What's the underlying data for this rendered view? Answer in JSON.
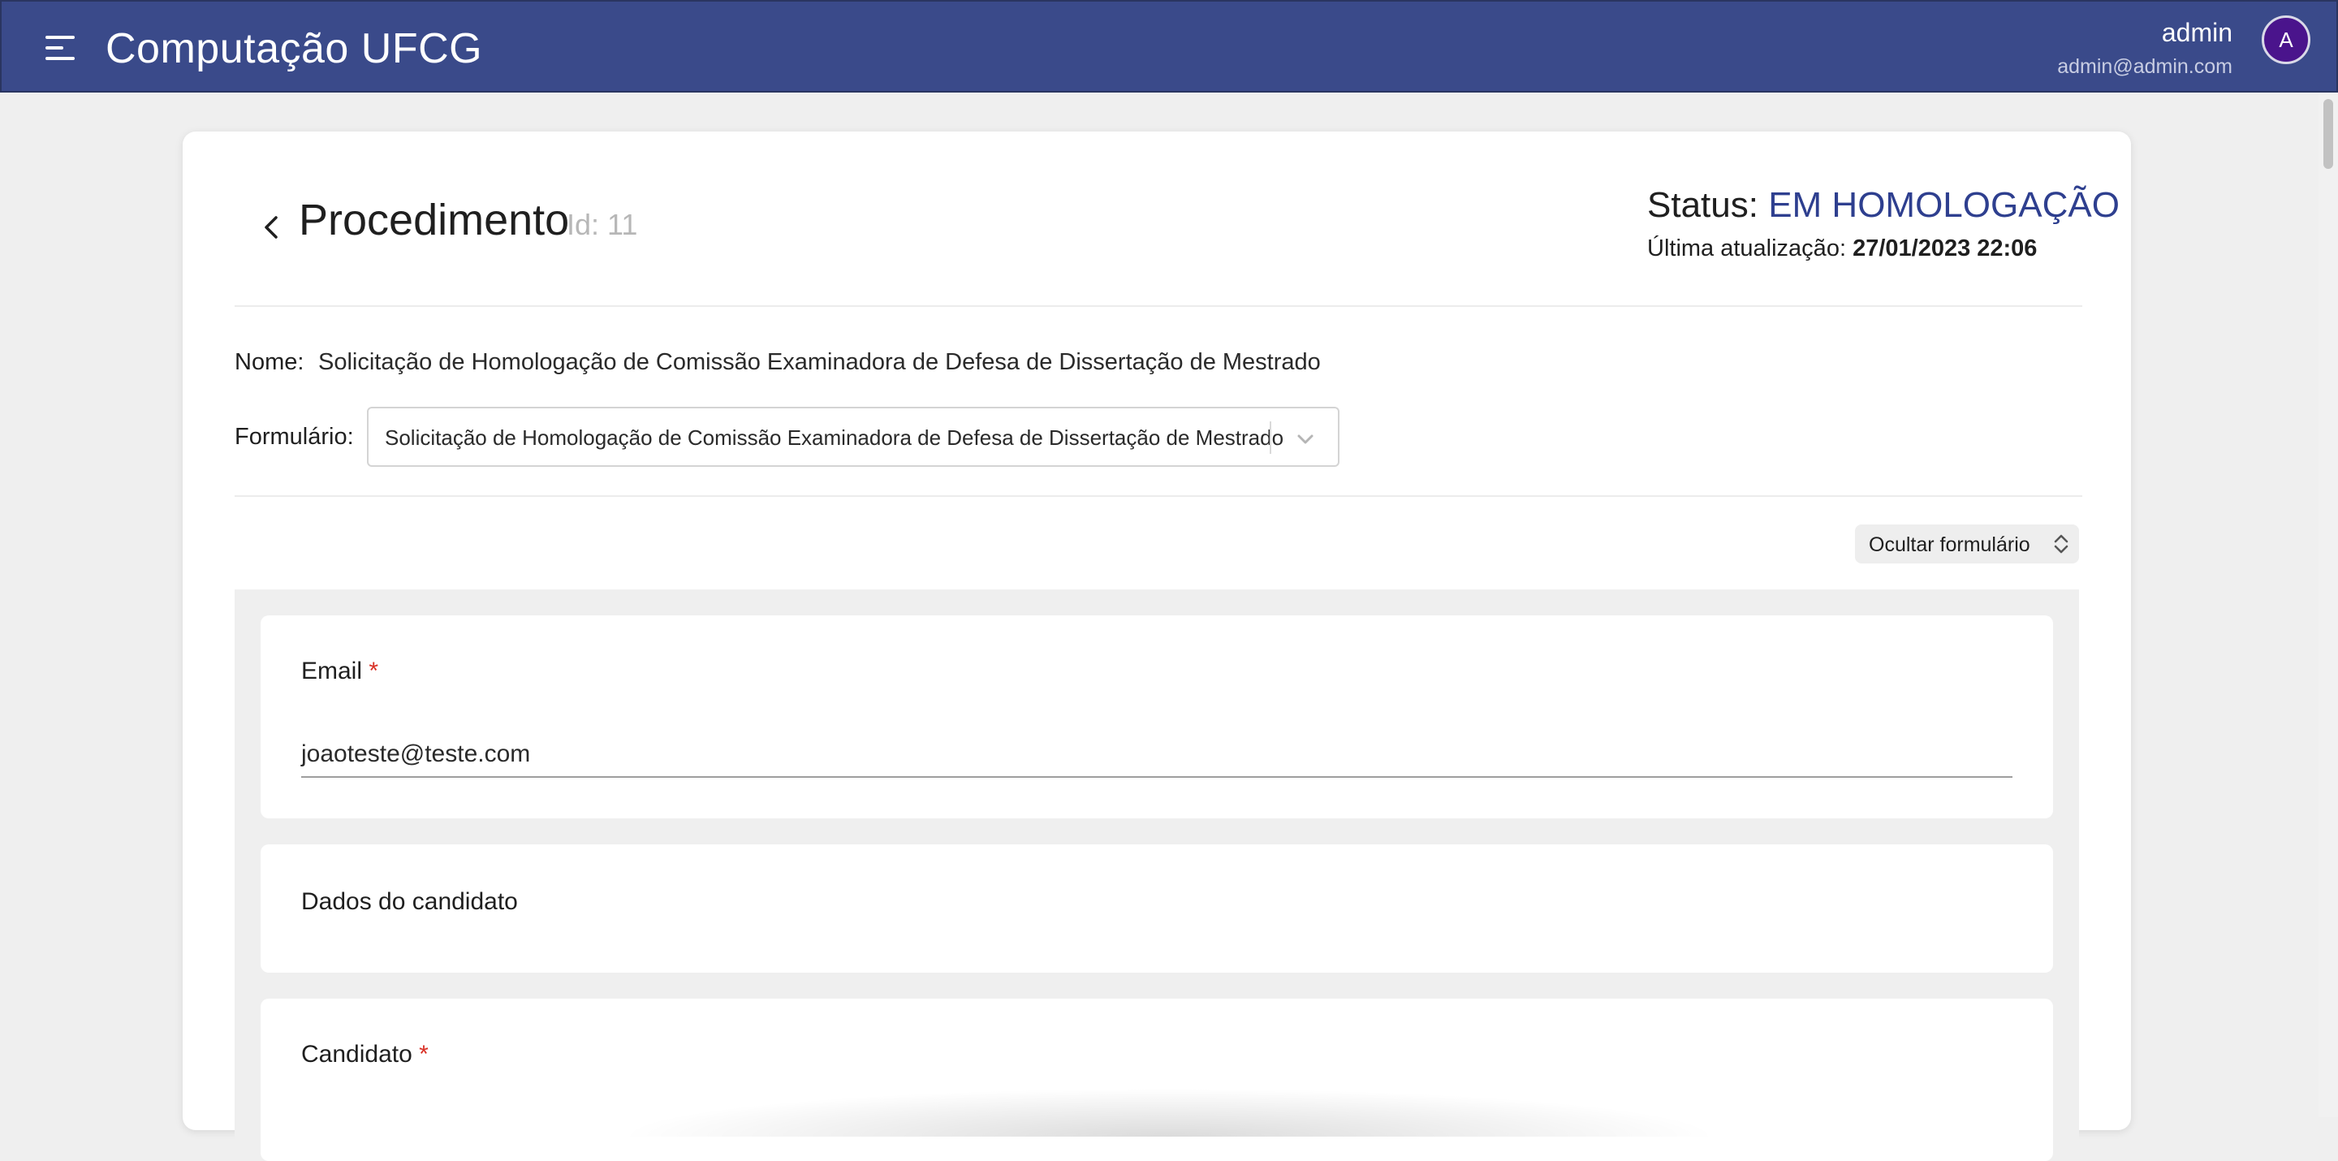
{
  "header": {
    "app_title": "Computação UFCG",
    "user_name": "admin",
    "user_email": "admin@admin.com",
    "avatar_initial": "A",
    "menu_icon": "menu-icon"
  },
  "page": {
    "title": "Procedimento",
    "id_text": "Id: 11",
    "status_label": "Status:",
    "status_value": "EM HOMOLOGAÇÃO",
    "update_label": "Última atualização:",
    "update_value": "27/01/2023 22:06"
  },
  "details": {
    "nome_label": "Nome:",
    "nome_value": "Solicitação de Homologação de Comissão Examinadora de Defesa de Dissertação de Mestrado",
    "formulario_label": "Formulário:",
    "formulario_value": "Solicitação de Homologação de Comissão Examinadora de Defesa de Dissertação de Mestrado"
  },
  "toggle": {
    "label": "Ocultar formulário"
  },
  "form": {
    "email_label": "Email",
    "email_required": "*",
    "email_value": "joaoteste@teste.com",
    "section_title": "Dados do candidato",
    "candidato_label": "Candidato",
    "candidato_required": "*"
  },
  "colors": {
    "header_bg": "#3a4a8a",
    "status_accent": "#2e3f8f",
    "required_red": "#d93025",
    "avatar_bg": "#4a148c"
  }
}
